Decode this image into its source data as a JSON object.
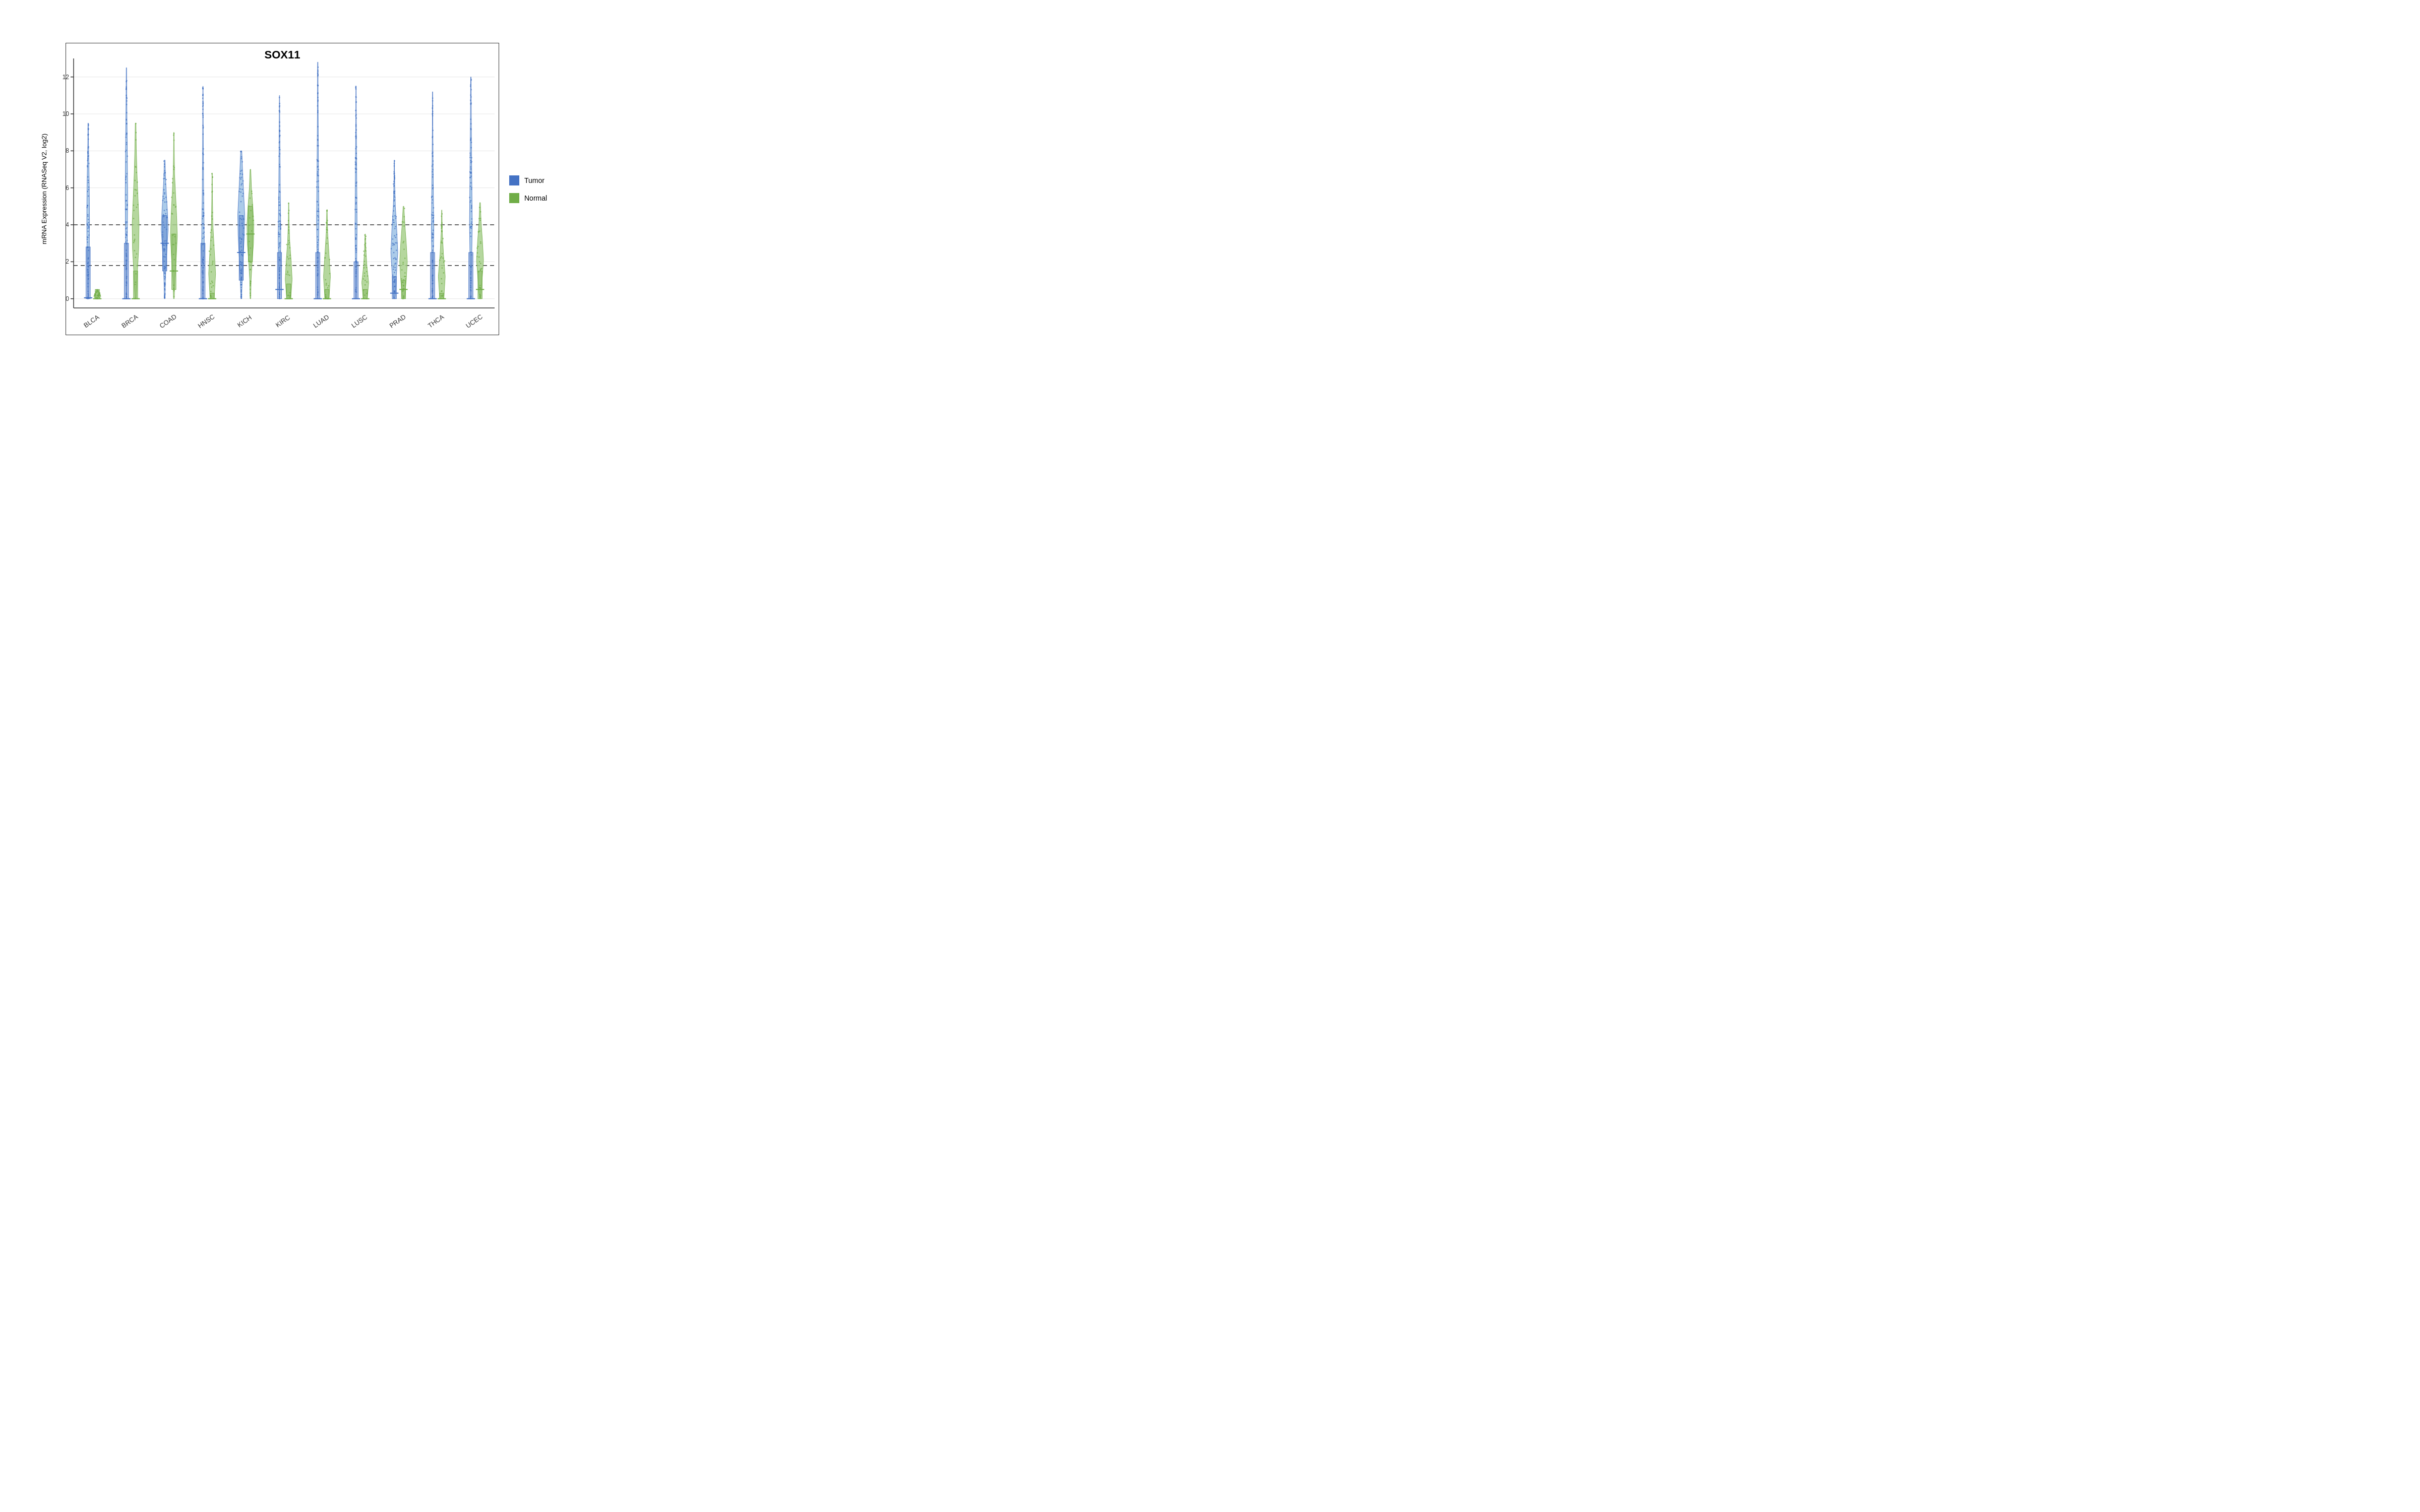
{
  "title": "SOX11",
  "y_axis_label": "mRNA Expression (RNASeq V2, log2)",
  "y_ticks": [
    0,
    2,
    4,
    6,
    8,
    10,
    12
  ],
  "y_min": -0.5,
  "y_max": 13,
  "x_labels": [
    "BLCA",
    "BRCA",
    "COAD",
    "HNSC",
    "KICH",
    "KIRC",
    "LUAD",
    "LUSC",
    "PRAD",
    "THCA",
    "UCEC"
  ],
  "dashed_lines": [
    1.8,
    4.0
  ],
  "legend": {
    "items": [
      {
        "label": "Tumor",
        "color": "#4472C4"
      },
      {
        "label": "Normal",
        "color": "#70AD47"
      }
    ]
  },
  "colors": {
    "tumor": "#4472C4",
    "tumor_light": "#9DC3E6",
    "normal": "#70AD47",
    "normal_light": "#A9D18E",
    "axis": "#333333",
    "dashed": "#333333"
  },
  "violins": [
    {
      "cancer": "BLCA",
      "tumor": {
        "median": 0.05,
        "q1": 0.0,
        "q3": 2.8,
        "whisker_low": 0.0,
        "whisker_high": 9.5,
        "width_profile": [
          0.05,
          0.1,
          0.15,
          0.18,
          0.2,
          0.18,
          0.15,
          0.1,
          0.05,
          0.03
        ]
      },
      "normal": {
        "median": 0.0,
        "q1": 0.0,
        "q3": 0.5,
        "whisker_low": 0.0,
        "whisker_high": 0.5,
        "width_profile": [
          0.3,
          0.5,
          0.4,
          0.2,
          0.1
        ]
      }
    },
    {
      "cancer": "BRCA",
      "tumor": {
        "median": 0.0,
        "q1": 0.0,
        "q3": 3.0,
        "whisker_low": 0.0,
        "whisker_high": 12.5,
        "width_profile": [
          0.05,
          0.08,
          0.12,
          0.15,
          0.18,
          0.15,
          0.12,
          0.08,
          0.05,
          0.03
        ]
      },
      "normal": {
        "median": 0.0,
        "q1": 0.0,
        "q3": 1.5,
        "whisker_low": 0.0,
        "whisker_high": 9.5,
        "width_profile": [
          0.1,
          0.25,
          0.45,
          0.5,
          0.35,
          0.2,
          0.1,
          0.05
        ]
      }
    },
    {
      "cancer": "COAD",
      "tumor": {
        "median": 3.0,
        "q1": 1.5,
        "q3": 4.5,
        "whisker_low": 0.0,
        "whisker_high": 7.5,
        "width_profile": [
          0.05,
          0.1,
          0.2,
          0.35,
          0.5,
          0.4,
          0.25,
          0.12,
          0.05
        ]
      },
      "normal": {
        "median": 1.5,
        "q1": 0.5,
        "q3": 3.5,
        "whisker_low": 0.0,
        "whisker_high": 9.0,
        "width_profile": [
          0.05,
          0.15,
          0.35,
          0.5,
          0.4,
          0.25,
          0.1,
          0.05,
          0.02
        ]
      }
    },
    {
      "cancer": "HNSC",
      "tumor": {
        "median": 0.0,
        "q1": 0.0,
        "q3": 3.0,
        "whisker_low": 0.0,
        "whisker_high": 11.5,
        "width_profile": [
          0.05,
          0.1,
          0.2,
          0.15,
          0.1,
          0.08,
          0.05,
          0.03,
          0.02
        ]
      },
      "normal": {
        "median": 0.0,
        "q1": 0.0,
        "q3": 0.3,
        "whisker_low": 0.0,
        "whisker_high": 6.8,
        "width_profile": [
          0.3,
          0.5,
          0.3,
          0.1,
          0.05,
          0.02
        ]
      }
    },
    {
      "cancer": "KICH",
      "tumor": {
        "median": 2.5,
        "q1": 1.0,
        "q3": 4.5,
        "whisker_low": 0.0,
        "whisker_high": 8.0,
        "width_profile": [
          0.05,
          0.15,
          0.3,
          0.45,
          0.5,
          0.35,
          0.2,
          0.08
        ]
      },
      "normal": {
        "median": 3.5,
        "q1": 2.0,
        "q3": 5.0,
        "whisker_low": 0.0,
        "whisker_high": 7.0,
        "width_profile": [
          0.05,
          0.1,
          0.25,
          0.45,
          0.5,
          0.35,
          0.15,
          0.05
        ]
      }
    },
    {
      "cancer": "KIRC",
      "tumor": {
        "median": 0.5,
        "q1": 0.0,
        "q3": 2.5,
        "whisker_low": 0.0,
        "whisker_high": 11.0,
        "width_profile": [
          0.05,
          0.12,
          0.2,
          0.15,
          0.1,
          0.07,
          0.04,
          0.02
        ]
      },
      "normal": {
        "median": 0.0,
        "q1": 0.0,
        "q3": 0.8,
        "whisker_low": 0.0,
        "whisker_high": 5.2,
        "width_profile": [
          0.3,
          0.5,
          0.35,
          0.15,
          0.05,
          0.02
        ]
      }
    },
    {
      "cancer": "LUAD",
      "tumor": {
        "median": 0.0,
        "q1": 0.0,
        "q3": 2.5,
        "whisker_low": 0.0,
        "whisker_high": 12.8,
        "width_profile": [
          0.05,
          0.1,
          0.18,
          0.12,
          0.08,
          0.05,
          0.03
        ]
      },
      "normal": {
        "median": 0.0,
        "q1": 0.0,
        "q3": 0.5,
        "whisker_low": 0.0,
        "whisker_high": 4.8,
        "width_profile": [
          0.3,
          0.5,
          0.3,
          0.1,
          0.03
        ]
      }
    },
    {
      "cancer": "LUSC",
      "tumor": {
        "median": 0.0,
        "q1": 0.0,
        "q3": 2.0,
        "whisker_low": 0.0,
        "whisker_high": 11.5,
        "width_profile": [
          0.05,
          0.1,
          0.15,
          0.12,
          0.08,
          0.04,
          0.02
        ]
      },
      "normal": {
        "median": 0.0,
        "q1": 0.0,
        "q3": 0.5,
        "whisker_low": 0.0,
        "whisker_high": 3.5,
        "width_profile": [
          0.3,
          0.5,
          0.25,
          0.1,
          0.03
        ]
      }
    },
    {
      "cancer": "PRAD",
      "tumor": {
        "median": 0.3,
        "q1": 0.0,
        "q3": 1.2,
        "whisker_low": 0.0,
        "whisker_high": 7.5,
        "width_profile": [
          0.1,
          0.3,
          0.5,
          0.35,
          0.15,
          0.05,
          0.02
        ]
      },
      "normal": {
        "median": 0.5,
        "q1": 0.0,
        "q3": 1.0,
        "whisker_low": 0.0,
        "whisker_high": 5.0,
        "width_profile": [
          0.15,
          0.4,
          0.55,
          0.4,
          0.2,
          0.05
        ]
      }
    },
    {
      "cancer": "THCA",
      "tumor": {
        "median": 0.0,
        "q1": 0.0,
        "q3": 2.5,
        "whisker_low": 0.0,
        "whisker_high": 11.2,
        "width_profile": [
          0.05,
          0.1,
          0.18,
          0.12,
          0.07,
          0.04,
          0.02
        ]
      },
      "normal": {
        "median": 0.0,
        "q1": 0.0,
        "q3": 0.3,
        "whisker_low": 0.0,
        "whisker_high": 4.8,
        "width_profile": [
          0.3,
          0.5,
          0.25,
          0.08,
          0.02
        ]
      }
    },
    {
      "cancer": "UCEC",
      "tumor": {
        "median": 0.0,
        "q1": 0.0,
        "q3": 2.5,
        "whisker_low": 0.0,
        "whisker_high": 12.0,
        "width_profile": [
          0.05,
          0.12,
          0.2,
          0.15,
          0.1,
          0.06,
          0.03
        ]
      },
      "normal": {
        "median": 0.5,
        "q1": 0.0,
        "q3": 1.5,
        "whisker_low": 0.0,
        "whisker_high": 5.2,
        "width_profile": [
          0.1,
          0.3,
          0.5,
          0.35,
          0.15,
          0.05
        ]
      }
    }
  ]
}
